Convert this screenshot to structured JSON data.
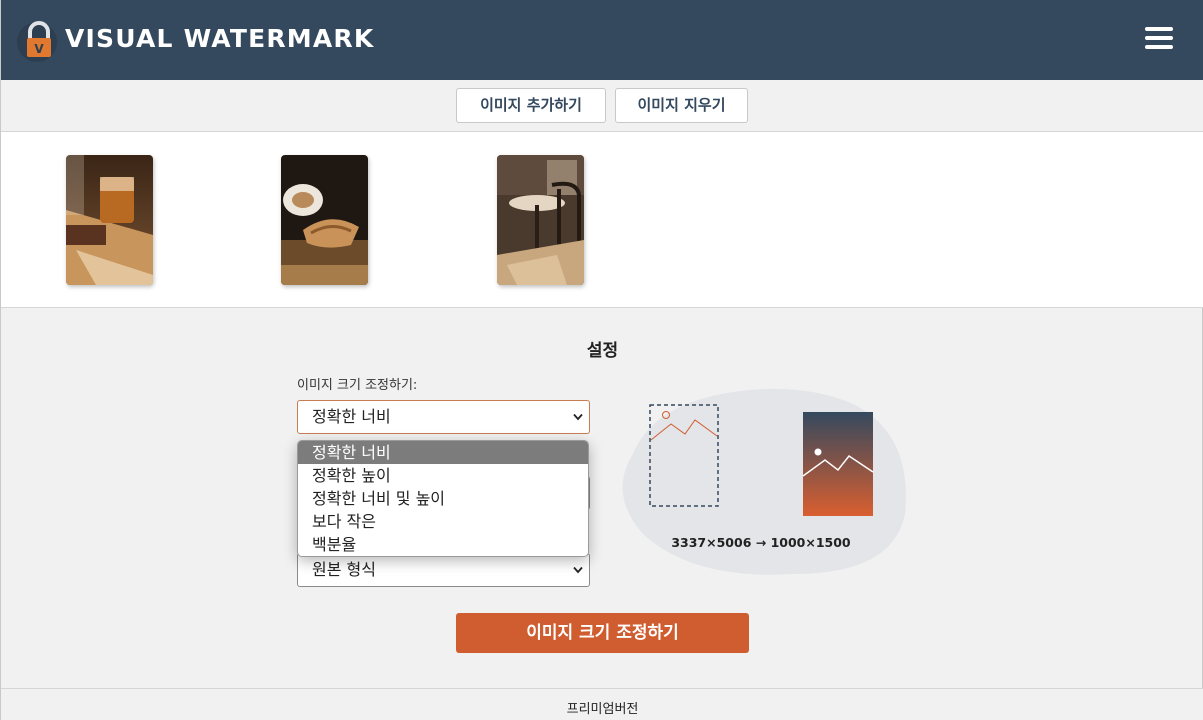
{
  "header": {
    "brand": "VISUAL WATERMARK",
    "logo_letter": "V",
    "brand_color": "#34495e",
    "menu_icon": "hamburger-icon"
  },
  "toolbar": {
    "add_images": "이미지 추가하기",
    "clear_images": "이미지 지우기"
  },
  "images": [
    {
      "subject": "iced drink and pastry on wooden tray"
    },
    {
      "subject": "latte cup and croissant"
    },
    {
      "subject": "cafe table and chairs"
    }
  ],
  "settings": {
    "title": "설정",
    "resize_label": "이미지 크기 조정하기:",
    "resize_selected": "정확한 너비",
    "resize_options": [
      "정확한 너비",
      "정확한 높이",
      "정확한 너비 및 높이",
      "보다 작은",
      "백분율"
    ],
    "format_selected": "원본 형식",
    "dimensions": "3337×5006 → 1000×1500",
    "accent_color": "#d05d30",
    "action_button": "이미지 크기 조정하기"
  },
  "footer": {
    "premium": "프리미엄버전"
  }
}
